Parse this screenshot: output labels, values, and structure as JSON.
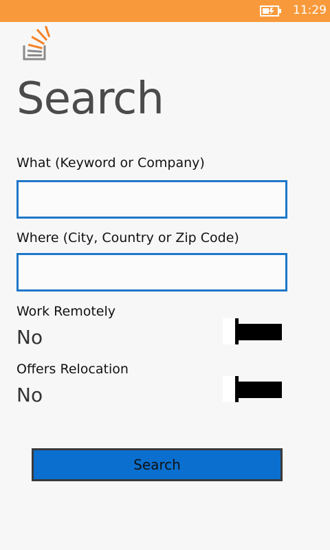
{
  "status_bar": {
    "time": "11:29",
    "battery_icon": "battery-charging-icon",
    "background": "#f89a3c"
  },
  "header": {
    "logo_icon": "stack-overflow-logo",
    "title": "Search"
  },
  "form": {
    "what": {
      "label": "What (Keyword or Company)",
      "value": ""
    },
    "where": {
      "label": "Where (City, Country or Zip Code)",
      "value": ""
    },
    "work_remotely": {
      "label": "Work Remotely",
      "value_text": "No",
      "checked": false
    },
    "offers_relocation": {
      "label": "Offers Relocation",
      "value_text": "No",
      "checked": false
    },
    "search_button": {
      "label": "Search"
    }
  },
  "colors": {
    "accent": "#1d77c9",
    "button": "#0a6fcf",
    "background": "#f7f7f7"
  }
}
